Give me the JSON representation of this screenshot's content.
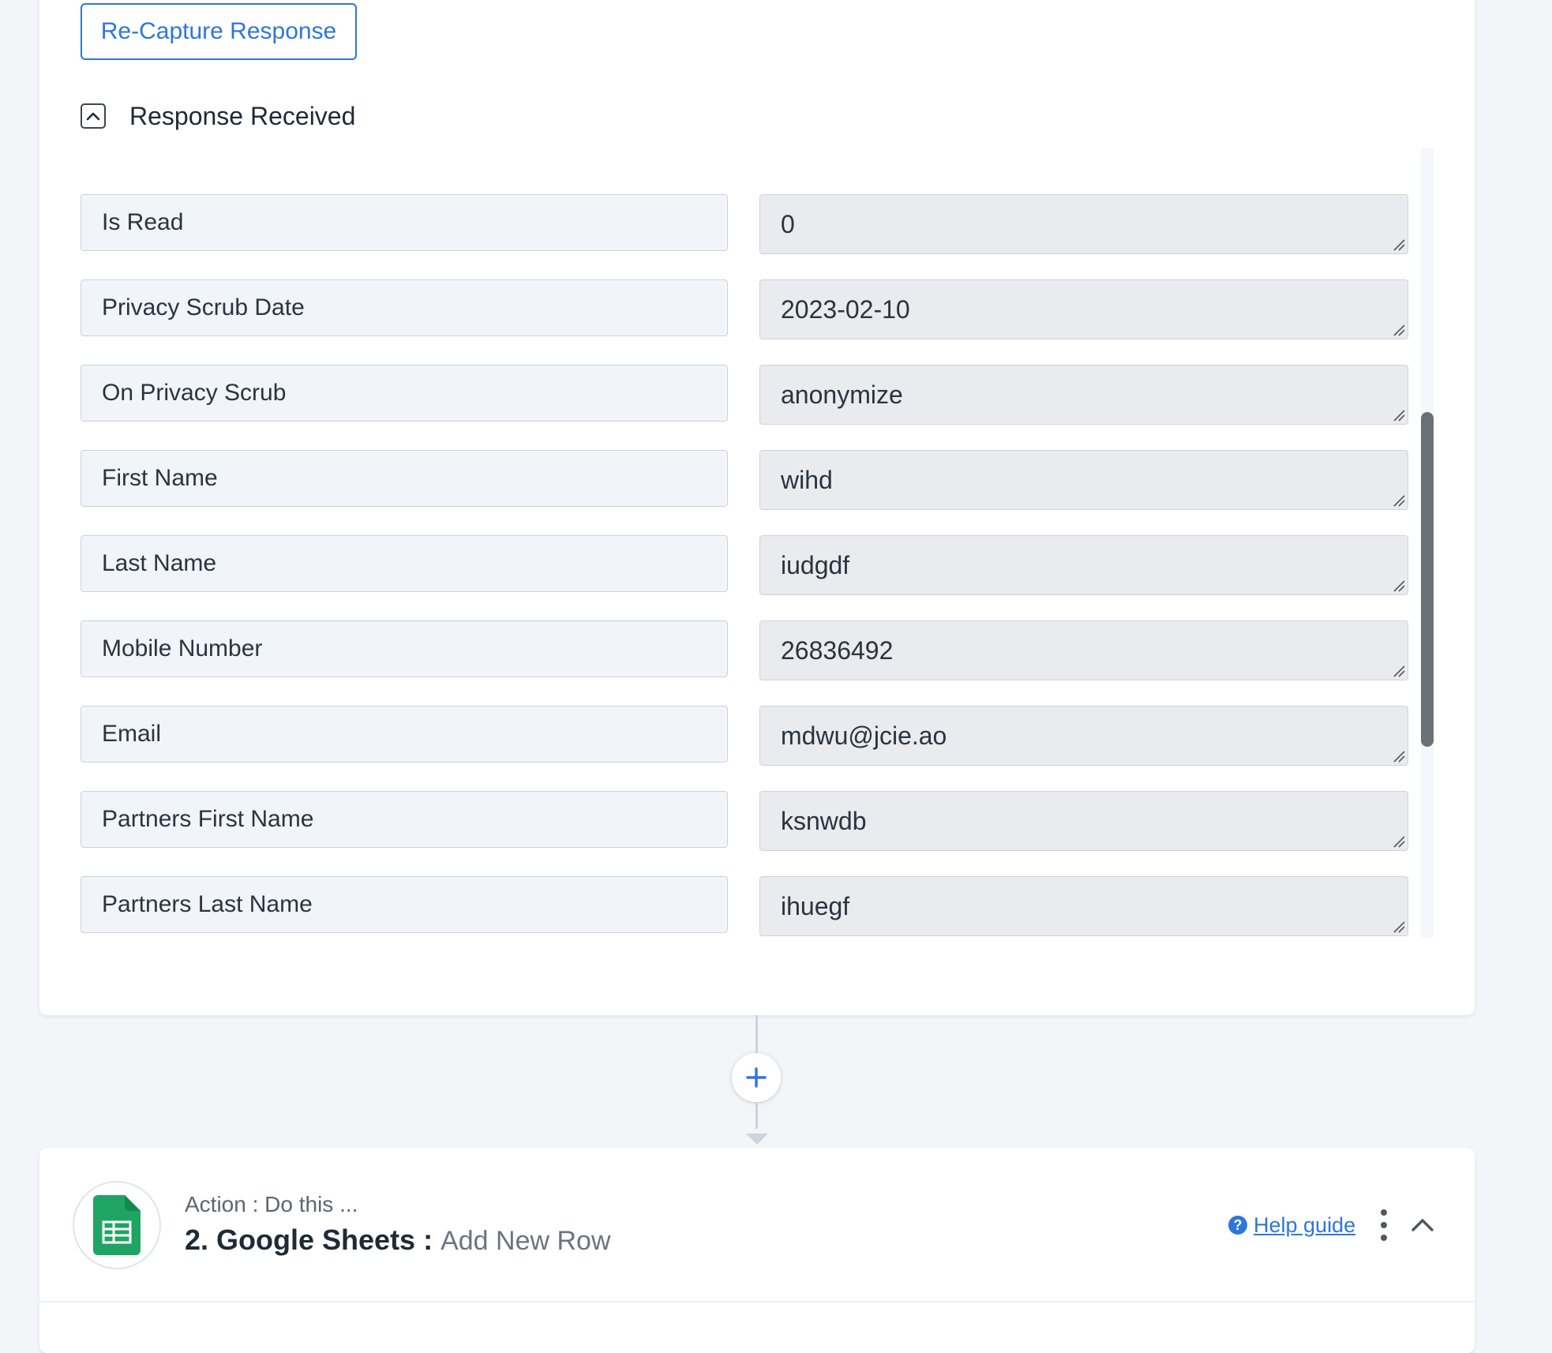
{
  "top_card": {
    "recapture_button": "Re-Capture Response",
    "response_title": "Response Received"
  },
  "fields": [
    {
      "label": "",
      "value": ""
    },
    {
      "label": "Is Read",
      "value": "0"
    },
    {
      "label": "Privacy Scrub Date",
      "value": "2023-02-10"
    },
    {
      "label": "On Privacy Scrub",
      "value": "anonymize"
    },
    {
      "label": "First Name",
      "value": "wihd"
    },
    {
      "label": "Last Name",
      "value": "iudgdf"
    },
    {
      "label": "Mobile Number",
      "value": "26836492"
    },
    {
      "label": "Email",
      "value": "mdwu@jcie.ao"
    },
    {
      "label": "Partners First Name",
      "value": "ksnwdb"
    },
    {
      "label": "Partners Last Name",
      "value": "ihuegf"
    }
  ],
  "action_card": {
    "subtitle": "Action : Do this ...",
    "step_name": "2. Google Sheets :",
    "step_event": "Add New Row",
    "help_label": "Help guide",
    "app_icon": "google-sheets-icon"
  },
  "colors": {
    "accent": "#2f76db",
    "sheets_green": "#1fa463",
    "page_bg": "#f3f6f9"
  }
}
